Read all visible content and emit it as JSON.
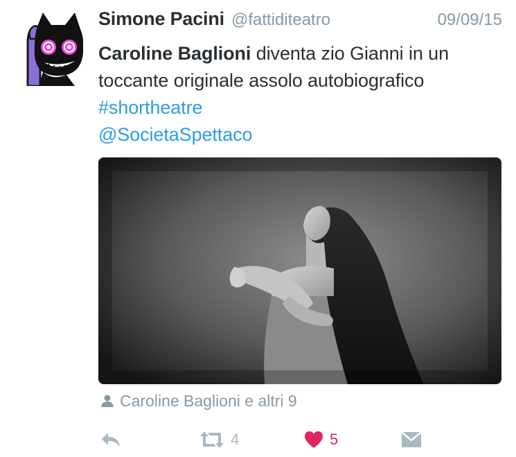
{
  "tweet": {
    "display_name": "Simone Pacini",
    "handle": "@fattiditeatro",
    "date": "09/09/15",
    "text": {
      "mention_name": "Caroline Baglioni",
      "body": " diventa zio Gianni in un toccante originale assolo autobiografico ",
      "hashtag": "#shortheatre",
      "mention_link": "@SocietaSpettaco"
    },
    "tagged": "Caroline Baglioni e altri 9",
    "actions": {
      "retweet_count": "4",
      "like_count": "5"
    }
  },
  "colors": {
    "link": "#2b9de4",
    "secondary_text": "#8899a6",
    "icon_gray": "#aab8c2",
    "like_red": "#e0245e",
    "avatar_purple": "#8b6fd6"
  },
  "icons": {
    "avatar": "cartoon-cat-avatar",
    "tagged": "person-icon",
    "reply": "reply-arrow-icon",
    "retweet": "retweet-icon",
    "like": "heart-icon",
    "dm": "envelope-icon"
  }
}
